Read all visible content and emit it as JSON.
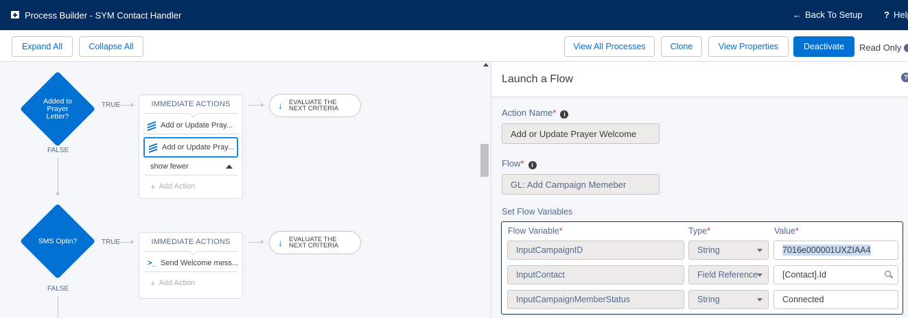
{
  "header": {
    "title": "Process Builder - SYM Contact Handler",
    "back_label": "Back To Setup",
    "help_label": "Help"
  },
  "toolbar": {
    "expand_all": "Expand All",
    "collapse_all": "Collapse All",
    "view_all_processes": "View All Processes",
    "clone": "Clone",
    "view_properties": "View Properties",
    "deactivate": "Deactivate",
    "read_only": "Read Only"
  },
  "canvas": {
    "criteria": [
      {
        "label": "Added to Prayer Letter?",
        "true_label": "TRUE",
        "false_label": "FALSE",
        "actions_header": "IMMEDIATE ACTIONS",
        "actions": [
          "Add or Update Pray...",
          "Add or Update Pray..."
        ],
        "show_fewer": "show fewer",
        "add_action": "Add Action",
        "evaluate_line1": "EVALUATE THE",
        "evaluate_line2": "NEXT CRITERIA"
      },
      {
        "label": "SMS Optin?",
        "true_label": "TRUE",
        "false_label": "FALSE",
        "actions_header": "IMMEDIATE ACTIONS",
        "actions": [
          "Send Welcome mess..."
        ],
        "add_action": "Add Action",
        "evaluate_line1": "EVALUATE THE",
        "evaluate_line2": "NEXT CRITERIA"
      }
    ]
  },
  "panel": {
    "title": "Launch a Flow",
    "action_name_label": "Action Name",
    "action_name_value": "Add or Update Prayer Welcome",
    "flow_label": "Flow",
    "flow_value": "GL: Add Campaign Memeber",
    "set_flow_variables_label": "Set Flow Variables",
    "columns": {
      "flow_variable": "Flow Variable",
      "type": "Type",
      "value": "Value"
    },
    "variables": [
      {
        "name": "InputCampaignID",
        "type": "String",
        "value": "7016e000001UXZIAA4"
      },
      {
        "name": "InputContact",
        "type": "Field Reference",
        "value": "[Contact].Id"
      },
      {
        "name": "InputCampaignMemberStatus",
        "type": "String",
        "value": "Connected"
      }
    ]
  },
  "colors": {
    "header_bg": "#032d60",
    "brand_blue": "#0070d2",
    "canvas_bg": "#f4f6f9",
    "selection": "#1589ee"
  }
}
